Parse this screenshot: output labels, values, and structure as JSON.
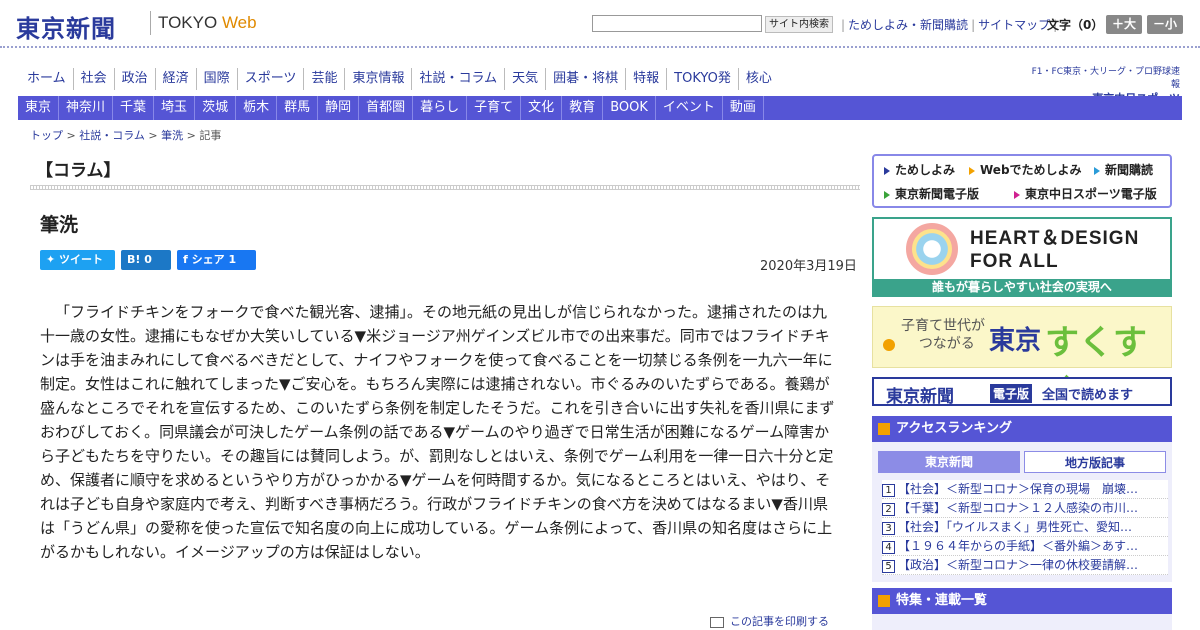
{
  "header": {
    "logo": "東京新聞",
    "logo_sub_a": "TOKYO",
    "logo_sub_b": "Web",
    "search_button": "サイト内検索",
    "links": [
      "ためしよみ・新聞購読",
      "サイトマップ"
    ],
    "font_size_label": "文字（0）",
    "font_large": "＋大",
    "font_small": "－小"
  },
  "nav_main": [
    "ホーム",
    "社会",
    "政治",
    "経済",
    "国際",
    "スポーツ",
    "芸能",
    "東京情報",
    "社説・コラム",
    "天気",
    "囲碁・将棋",
    "特報",
    "TOKYO発",
    "核心"
  ],
  "chunichi": {
    "line1": "F1・FC東京・大リーグ・プロ野球速報",
    "line2": "東京中日スポーツ"
  },
  "nav_sub": [
    "東京",
    "神奈川",
    "千葉",
    "埼玉",
    "茨城",
    "栃木",
    "群馬",
    "静岡",
    "首都圏",
    "暮らし",
    "子育て",
    "文化",
    "教育",
    "BOOK",
    "イベント",
    "動画"
  ],
  "breadcrumb": {
    "top": "トップ",
    "section": "社説・コラム",
    "sub": "筆洗",
    "current": "記事"
  },
  "column_label": "【コラム】",
  "article": {
    "title": "筆洗",
    "tweet": "ツイート",
    "hatena": "B! 0",
    "share": "シェア 1",
    "date": "2020年3月19日",
    "body": "「フライドチキンをフォークで食べた観光客、逮捕」。その地元紙の見出しが信じられなかった。逮捕されたのは九十一歳の女性。逮捕にもなぜか大笑いしている▼米ジョージア州ゲインズビル市での出来事だ。同市ではフライドチキンは手を油まみれにして食べるべきだとして、ナイフやフォークを使って食べることを一切禁じる条例を一九六一年に制定。女性はこれに触れてしまった▼ご安心を。もちろん実際には逮捕されない。市ぐるみのいたずらである。養鶏が盛んなところでそれを宣伝するため、このいたずら条例を制定したそうだ。これを引き合いに出す失礼を香川県にまずおわびしておく。同県議会が可決したゲーム条例の話である▼ゲームのやり過ぎで日常生活が困難になるゲーム障害から子どもたちを守りたい。その趣旨には賛同しよう。が、罰則なしとはいえ、条例でゲーム利用を一律一日六十分と定め、保護者に順守を求めるというやり方がひっかかる▼ゲームを何時間するか。気になるところとはいえ、やはり、それは子ども自身や家庭内で考え、判断すべき事柄だろう。行政がフライドチキンの食べ方を決めてはなるまい▼香川県は「うどん県」の愛称を使った宣伝で知名度の向上に成功している。ゲーム条例によって、香川県の知名度はさらに上がるかもしれない。イメージアップの方は保証はしない。",
    "print": "この記事を印刷する"
  },
  "quick_links": [
    "ためしよみ",
    "Webでためしよみ",
    "新聞購読",
    "東京新聞電子版",
    "東京中日スポーツ電子版"
  ],
  "heart_design": {
    "title_line1": "HEART＆DESIGN",
    "title_line2": "FOR ALL",
    "footer": "誰もが暮らしやすい社会の実現へ"
  },
  "sukusuku": {
    "line1": "子育て世代が",
    "line2": "つながる",
    "brand": "東京",
    "brand2": "すくすく"
  },
  "edition": {
    "a": "東京新聞",
    "b": "電子版",
    "c": "全国で読めます"
  },
  "ranking": {
    "title": "アクセスランキング",
    "tab1": "東京新聞",
    "tab2": "地方版記事",
    "items": [
      "1【社会】＜新型コロナ＞保育の現場　崩壊…",
      "2【千葉】＜新型コロナ＞１２人感染の市川…",
      "3【社会】「ウイルスまく」男性死亡、愛知…",
      "4【１９６４年からの手紙】＜番外編＞あす…",
      "5【政治】＜新型コロナ＞一律の休校要請解…"
    ]
  },
  "features": {
    "title": "特集・連載一覧"
  }
}
